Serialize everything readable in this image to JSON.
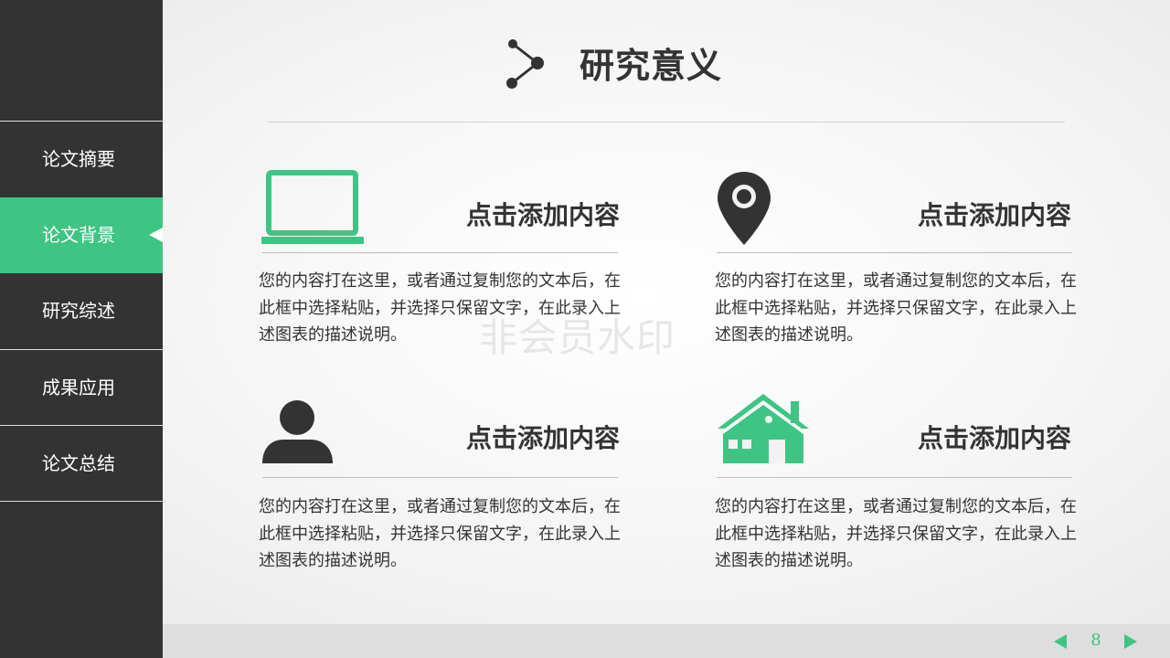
{
  "sidebar": {
    "items": [
      {
        "label": "论文摘要",
        "active": false
      },
      {
        "label": "论文背景",
        "active": true
      },
      {
        "label": "研究综述",
        "active": false
      },
      {
        "label": "成果应用",
        "active": false
      },
      {
        "label": "论文总结",
        "active": false
      }
    ]
  },
  "header": {
    "title": "研究意义",
    "icon": "share-icon"
  },
  "cards": [
    {
      "icon": "laptop-icon",
      "heading": "点击添加内容",
      "body": "您的内容打在这里，或者通过复制您的文本后，在此框中选择粘贴，并选择只保留文字，在此录入上述图表的描述说明。"
    },
    {
      "icon": "location-pin-icon",
      "heading": "点击添加内容",
      "body": "您的内容打在这里，或者通过复制您的文本后，在此框中选择粘贴，并选择只保留文字，在此录入上述图表的描述说明。"
    },
    {
      "icon": "user-icon",
      "heading": "点击添加内容",
      "body": "您的内容打在这里，或者通过复制您的文本后，在此框中选择粘贴，并选择只保留文字，在此录入上述图表的描述说明。"
    },
    {
      "icon": "house-icon",
      "heading": "点击添加内容",
      "body": "您的内容打在这里，或者通过复制您的文本后，在此框中选择粘贴，并选择只保留文字，在此录入上述图表的描述说明。"
    }
  ],
  "watermark": "非会员水印",
  "footer": {
    "page_number": "8"
  },
  "colors": {
    "accent": "#3ec583",
    "sidebar_bg": "#333333",
    "text": "#333333"
  }
}
